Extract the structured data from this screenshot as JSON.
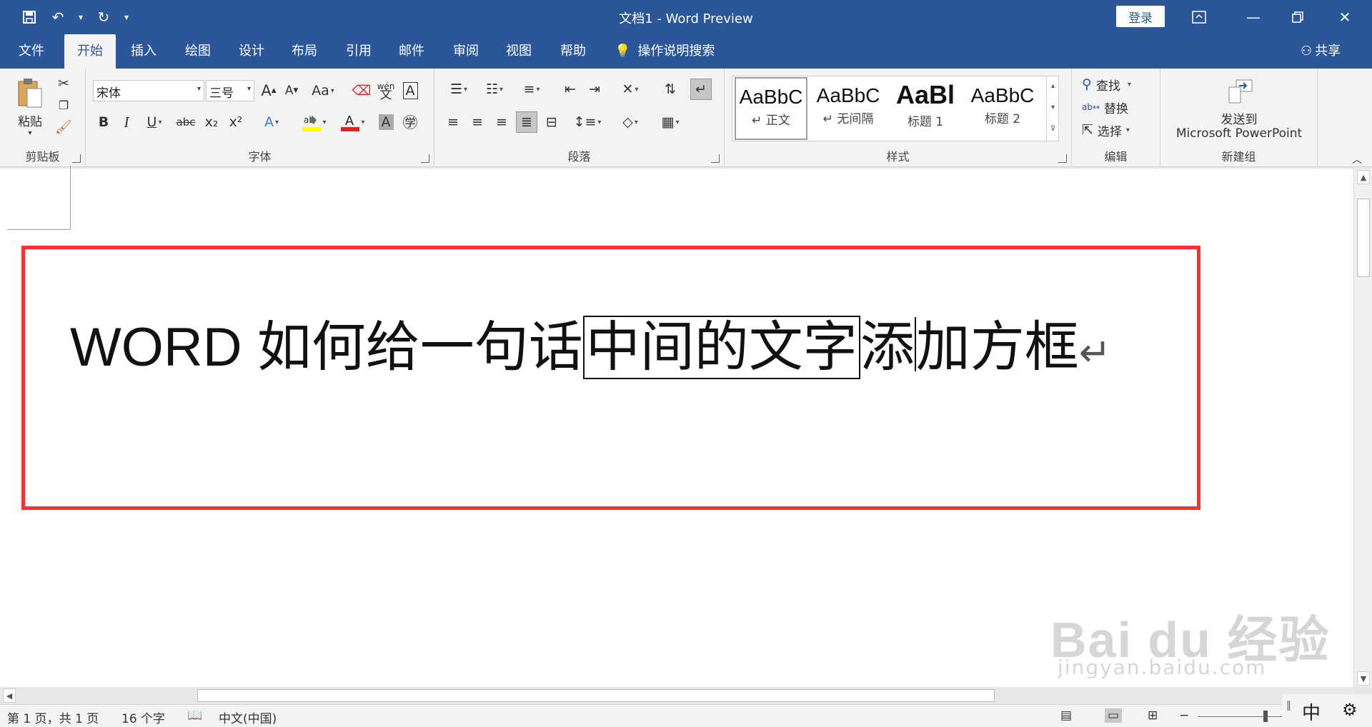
{
  "window": {
    "title": "文档1  -  Word Preview",
    "login_label": "登录"
  },
  "tabs": [
    "文件",
    "开始",
    "插入",
    "绘图",
    "设计",
    "布局",
    "引用",
    "邮件",
    "审阅",
    "视图",
    "帮助"
  ],
  "tell_me": "操作说明搜索",
  "share_label": "共享",
  "clipboard": {
    "paste_label": "粘贴",
    "group_label": "剪贴板"
  },
  "font": {
    "name": "宋体",
    "size": "三号",
    "grow": "A",
    "shrink": "A",
    "case": "Aa",
    "bold": "B",
    "italic": "I",
    "underline": "U",
    "strike": "abc",
    "sub": "x₂",
    "sup": "x²",
    "group_label": "字体",
    "font_color": "#e0201f",
    "highlight_color": "#ffff00"
  },
  "paragraph": {
    "group_label": "段落"
  },
  "styles": {
    "items": [
      {
        "sample": "AaBbC",
        "name": "↵ 正文"
      },
      {
        "sample": "AaBbC",
        "name": "↵ 无间隔"
      },
      {
        "sample": "AaBl",
        "name": "标题 1"
      },
      {
        "sample": "AaBbC",
        "name": "标题 2"
      }
    ],
    "group_label": "样式"
  },
  "editing": {
    "find": "查找",
    "replace": "替换",
    "select": "选择",
    "group_label": "编辑"
  },
  "newgroup": {
    "send_line1": "发送到",
    "send_line2": "Microsoft PowerPoint",
    "group_label": "新建组"
  },
  "document": {
    "text_before": "WORD 如何给一句话",
    "text_boxed": "中间的文字",
    "text_mid": "添",
    "text_after": "加方框",
    "para_mark": "↵",
    "highlight_color": "#ff2f2f"
  },
  "watermark": {
    "line1": "Bai du 经验",
    "line2": "jingyan.baidu.com"
  },
  "status": {
    "page": "第 1 页，共 1 页",
    "words": "16 个字",
    "lang": "中文(中国)",
    "ime": "中"
  }
}
